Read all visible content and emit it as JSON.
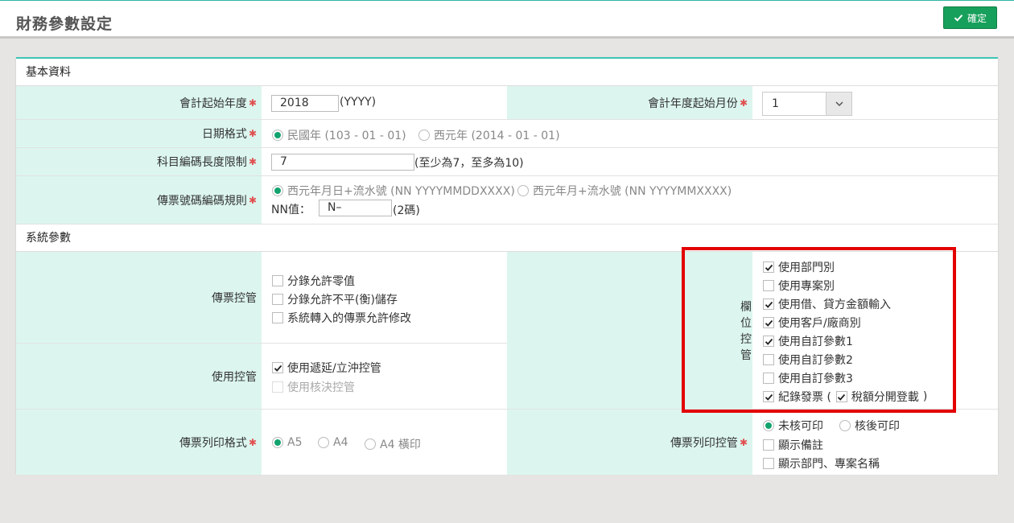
{
  "header": {
    "title": "財務參數設定",
    "confirm_label": "確定"
  },
  "sections": {
    "basic": "基本資料",
    "system": "系統參數"
  },
  "basic": {
    "fiscal_start_year": {
      "label": "會計起始年度",
      "value": "2018",
      "hint": "(YYYY)"
    },
    "fiscal_start_month": {
      "label": "會計年度起始月份",
      "value": "1"
    },
    "date_format": {
      "label": "日期格式",
      "options": [
        "民國年 (103 - 01 - 01)",
        "西元年 (2014 - 01 - 01)"
      ],
      "selected": 0
    },
    "account_code_length": {
      "label": "科目編碼長度限制",
      "value": "7",
      "hint": "(至少為7，至多為10)"
    },
    "voucher_rule": {
      "label": "傳票號碼編碼規則",
      "options": [
        "西元年月日+流水號 (NN YYYYMMDDXXXX)",
        "西元年月+流水號 (NN YYYYMMXXXX)"
      ],
      "selected": 0,
      "nn_label": "NN值：",
      "nn_value": "N–",
      "nn_hint": "(2碼)"
    }
  },
  "system": {
    "voucher_control": {
      "label": "傳票控管",
      "items": [
        {
          "text": "分錄允許零值",
          "checked": false
        },
        {
          "text": "分錄允許不平(衡)儲存",
          "checked": false
        },
        {
          "text": "系統轉入的傳票允許修改",
          "checked": false
        }
      ]
    },
    "usage_control": {
      "label": "使用控管",
      "items": [
        {
          "text": "使用遞延/立沖控管",
          "checked": true
        },
        {
          "text": "使用核決控管",
          "checked": false
        }
      ]
    },
    "field_control": {
      "label": "欄位控管",
      "items": [
        {
          "text": "使用部門別",
          "checked": true
        },
        {
          "text": "使用專案別",
          "checked": false
        },
        {
          "text": "使用借、貸方金額輸入",
          "checked": true
        },
        {
          "text": "使用客戶/廠商別",
          "checked": true
        },
        {
          "text": "使用自訂參數1",
          "checked": true
        },
        {
          "text": "使用自訂參數2",
          "checked": false
        },
        {
          "text": "使用自訂參數3",
          "checked": false
        }
      ],
      "last": {
        "text": "紀錄發票 (",
        "checked": true,
        "sub_text": "稅額分開登載",
        "sub_checked": true,
        "close": ")"
      }
    },
    "print_format": {
      "label": "傳票列印格式",
      "options": [
        "A5",
        "A4",
        "A4 橫印"
      ],
      "selected": 0
    },
    "print_control": {
      "label": "傳票列印控管",
      "radios": [
        "未核可印",
        "核後可印"
      ],
      "selected": 0,
      "checks": [
        {
          "text": "顯示備註",
          "checked": false
        },
        {
          "text": "顯示部門、專案名稱",
          "checked": false
        }
      ]
    }
  },
  "colors": {
    "accent": "#13a36e",
    "label_bg": "#dcf6ef",
    "highlight": "#e30000",
    "button": "#17a05b"
  }
}
